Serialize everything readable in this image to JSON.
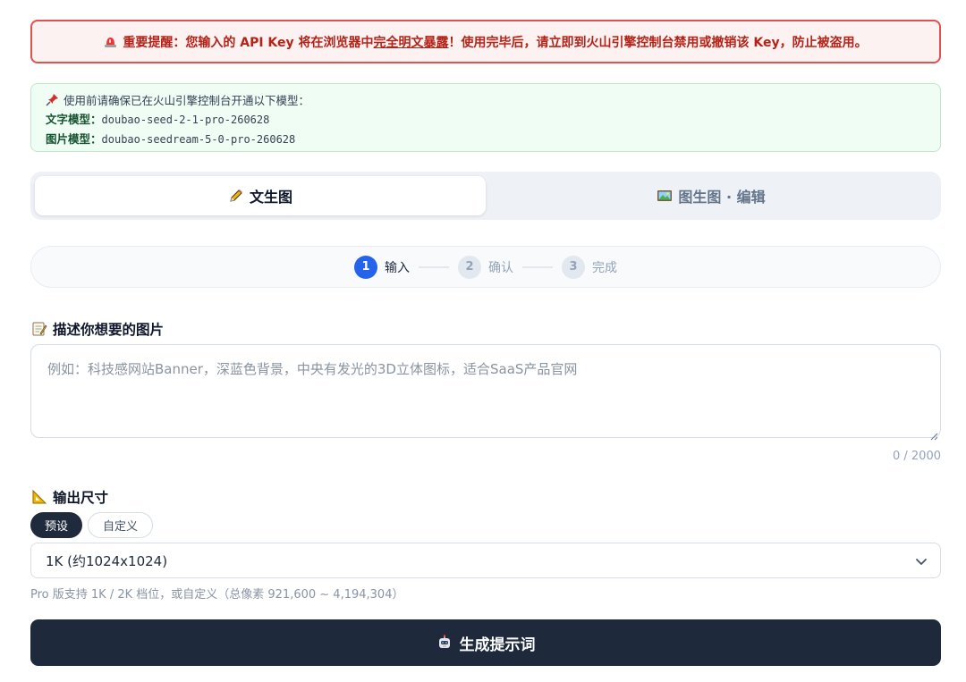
{
  "alert": {
    "prefix": "重要提醒：您输入的 API Key 将在浏览器中",
    "underline": "完全明文暴露",
    "suffix": "！使用完毕后，请立即到火山引擎控制台禁用或撤销该 Key，防止被盗用。",
    "icon": "siren-icon"
  },
  "models_notice": {
    "intro": "使用前请确保已在火山引擎控制台开通以下模型：",
    "icon": "pushpin-icon",
    "text_label": "文字模型：",
    "text_model": "doubao-seed-2-1-pro-260628",
    "image_label": "图片模型：",
    "image_model": "doubao-seedream-5-0-pro-260628"
  },
  "tabs": [
    {
      "label": "文生图",
      "icon": "pencil-icon",
      "active": true
    },
    {
      "label": "图生图 · 编辑",
      "icon": "picture-icon",
      "active": false
    }
  ],
  "steps": [
    {
      "num": "1",
      "label": "输入",
      "active": true
    },
    {
      "num": "2",
      "label": "确认",
      "active": false
    },
    {
      "num": "3",
      "label": "完成",
      "active": false
    }
  ],
  "prompt": {
    "title": "描述你想要的图片",
    "icon": "memo-icon",
    "placeholder": "例如：科技感网站Banner，深蓝色背景，中央有发光的3D立体图标，适合SaaS产品官网",
    "value": "",
    "counter": "0 / 2000"
  },
  "size": {
    "title": "输出尺寸",
    "icon": "triangle-ruler-icon",
    "modes": [
      "预设",
      "自定义"
    ],
    "selected_mode": "预设",
    "selected": "1K (约1024x1024)",
    "hint": "Pro 版支持 1K / 2K 档位，或自定义（总像素 921,600 ~ 4,194,304）"
  },
  "submit": {
    "label": "生成提示词",
    "icon": "robot-icon"
  },
  "colors": {
    "alert_border": "#e05252",
    "alert_text": "#b42318",
    "notice_bg": "#f0fdf4",
    "step_active": "#2563eb",
    "primary_dark": "#1e293b"
  }
}
